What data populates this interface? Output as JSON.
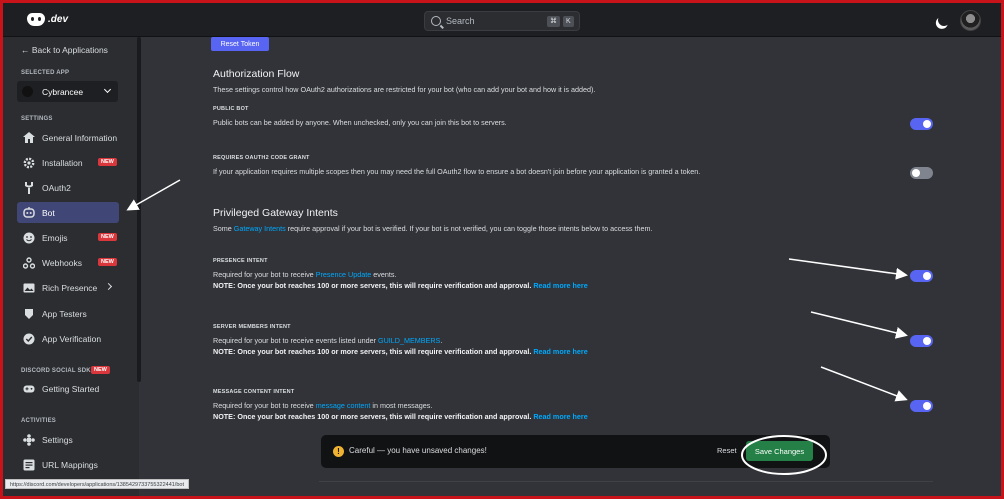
{
  "topbar": {
    "logo_text": ".dev",
    "search_placeholder": "Search",
    "shortcut_key_1": "⌘",
    "shortcut_key_2": "K"
  },
  "sidebar": {
    "back_label": "← Back to Applications",
    "selected_app_heading": "SELECTED APP",
    "selected_app": "Cybrancee",
    "settings_heading": "SETTINGS",
    "items": [
      {
        "label": "General Information",
        "icon": "home-icon",
        "badge": ""
      },
      {
        "label": "Installation",
        "icon": "gear-icon",
        "badge": "NEW"
      },
      {
        "label": "OAuth2",
        "icon": "wrench-icon",
        "badge": ""
      },
      {
        "label": "Bot",
        "icon": "robot-icon",
        "badge": "",
        "active": true
      },
      {
        "label": "Emojis",
        "icon": "emoji-icon",
        "badge": "NEW"
      },
      {
        "label": "Webhooks",
        "icon": "webhook-icon",
        "badge": "NEW"
      },
      {
        "label": "Rich Presence",
        "icon": "picture-icon",
        "badge": ""
      },
      {
        "label": "App Testers",
        "icon": "testers-icon",
        "badge": ""
      },
      {
        "label": "App Verification",
        "icon": "verify-icon",
        "badge": ""
      }
    ],
    "sdk_heading": "DISCORD SOCIAL SDK",
    "sdk_badge": "NEW",
    "sdk_items": [
      {
        "label": "Getting Started",
        "icon": "gamepad-icon"
      }
    ],
    "activities_heading": "ACTIVITIES",
    "activities_items": [
      {
        "label": "Settings",
        "icon": "puzzle-icon"
      },
      {
        "label": "URL Mappings",
        "icon": "link-icon"
      }
    ]
  },
  "main": {
    "reset_token_label": "Reset Token",
    "auth_flow": {
      "title": "Authorization Flow",
      "desc": "These settings control how OAuth2 authorizations are restricted for your bot (who can add your bot and how it is added)."
    },
    "public_bot": {
      "label": "PUBLIC BOT",
      "text": "Public bots can be added by anyone. When unchecked, only you can join this bot to servers.",
      "enabled": true
    },
    "oauth2_grant": {
      "label": "REQUIRES OAUTH2 CODE GRANT",
      "text": "If your application requires multiple scopes then you may need the full OAuth2 flow to ensure a bot doesn't join before your application is granted a token.",
      "enabled": false
    },
    "intents": {
      "title": "Privileged Gateway Intents",
      "desc_pre": "Some ",
      "desc_link": "Gateway Intents",
      "desc_post": " require approval if your bot is verified. If your bot is not verified, you can toggle those intents below to access them."
    },
    "presence": {
      "label": "PRESENCE INTENT",
      "text_pre": "Required for your bot to receive ",
      "text_link": "Presence Update",
      "text_post": " events.",
      "note": "NOTE: Once your bot reaches 100 or more servers, this will require verification and approval.",
      "read_more": "Read more here",
      "enabled": true
    },
    "members": {
      "label": "SERVER MEMBERS INTENT",
      "text_pre": "Required for your bot to receive events listed under ",
      "text_link": "GUILD_MEMBERS",
      "text_post": ".",
      "note": "NOTE: Once your bot reaches 100 or more servers, this will require verification and approval.",
      "read_more": "Read more here",
      "enabled": true
    },
    "message_content": {
      "label": "MESSAGE CONTENT INTENT",
      "text_pre": "Required for your bot to receive ",
      "text_link": "message content",
      "text_post": " in most messages.",
      "note": "NOTE: Once your bot reaches 100 or more servers, this will require verification and approval.",
      "read_more": "Read more here",
      "enabled": true
    }
  },
  "unsaved": {
    "icon": "!",
    "message": "Careful — you have unsaved changes!",
    "reset_label": "Reset",
    "save_label": "Save Changes"
  },
  "statusbar": {
    "url": "https://discord.com/developers/applications/1385429733755322441/bot"
  },
  "colors": {
    "accent": "#5865f2",
    "save_green": "#248046",
    "link": "#00a8fc",
    "new_badge": "#da373c",
    "frame_red": "#c8131b"
  }
}
